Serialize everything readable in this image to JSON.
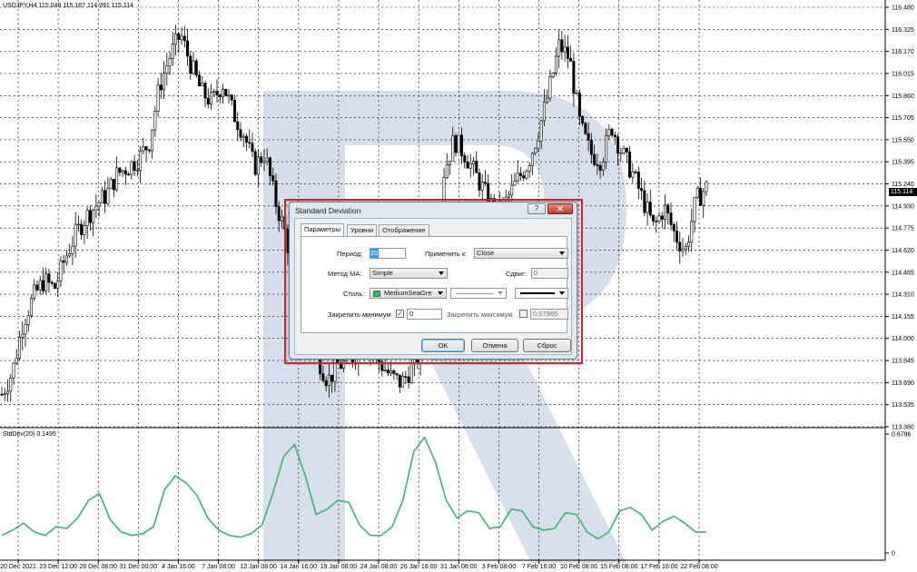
{
  "chart": {
    "symbol_caption": "USDJPY,H4  115.049 115.167 114.991 115.114",
    "current_price": "115.114",
    "indicator_caption": "StdDev(20) 0.1495",
    "price_ticks": [
      "116.480",
      "116.325",
      "116.170",
      "116.015",
      "115.860",
      "115.705",
      "115.550",
      "115.395",
      "115.240",
      "114.930",
      "114.775",
      "114.620",
      "114.465",
      "114.310",
      "114.155",
      "114.000",
      "113.845",
      "113.690",
      "113.535",
      "113.380"
    ],
    "indicator_ticks": [
      "0.6796",
      "0"
    ],
    "time_ticks": [
      "20 Dec 2021",
      "23 Dec 12:00",
      "28 Dec 08:00",
      "31 Dec 00:00",
      "4 Jan 16:00",
      "7 Jan 08:00",
      "12 Jan 08:00",
      "14 Jan 16:00",
      "19 Jan 08:00",
      "24 Jan 08:00",
      "26 Jan 16:00",
      "31 Jan 08:00",
      "3 Feb 08:00",
      "7 Feb 16:00",
      "10 Feb 08:00",
      "15 Feb 08:00",
      "17 Feb 16:00",
      "22 Feb 08:00"
    ],
    "colors": {
      "up_candle": "#000000",
      "indicator_line": "#3cb371",
      "grid": "#000000",
      "watermark": "#c9d3e6",
      "highlight_frame": "#e21d24"
    }
  },
  "chart_data": {
    "type": "line",
    "title": "USDJPY,H4",
    "series": [
      {
        "name": "USDJPY close",
        "values": [
          113.62,
          113.78,
          114.15,
          114.34,
          114.46,
          114.4,
          114.62,
          114.8,
          114.93,
          115.02,
          115.1,
          115.25,
          115.3,
          115.36,
          115.48,
          115.9,
          116.12,
          116.28,
          116.05,
          115.85,
          115.78,
          115.92,
          115.7,
          115.55,
          115.3,
          115.4,
          115.05,
          114.8,
          114.4,
          114.1,
          113.9,
          113.72,
          113.84,
          113.85,
          113.96,
          113.98,
          113.85,
          113.75,
          113.7,
          113.82,
          113.95,
          114.4,
          115.25,
          115.5,
          115.4,
          115.25,
          115.1,
          114.95,
          115.05,
          115.2,
          115.32,
          115.55,
          115.85,
          116.2,
          116.1,
          115.6,
          115.4,
          115.35,
          115.6,
          115.4,
          115.25,
          115.05,
          114.85,
          115.0,
          114.8,
          114.68,
          115.05,
          115.15
        ]
      },
      {
        "name": "StdDev(20)",
        "values": [
          0.1,
          0.13,
          0.17,
          0.12,
          0.1,
          0.15,
          0.14,
          0.2,
          0.3,
          0.34,
          0.19,
          0.12,
          0.1,
          0.11,
          0.15,
          0.36,
          0.44,
          0.4,
          0.33,
          0.2,
          0.13,
          0.1,
          0.09,
          0.11,
          0.16,
          0.34,
          0.55,
          0.62,
          0.44,
          0.22,
          0.25,
          0.3,
          0.29,
          0.16,
          0.1,
          0.1,
          0.15,
          0.3,
          0.58,
          0.66,
          0.52,
          0.3,
          0.2,
          0.24,
          0.23,
          0.14,
          0.15,
          0.25,
          0.24,
          0.15,
          0.13,
          0.14,
          0.23,
          0.22,
          0.12,
          0.08,
          0.12,
          0.24,
          0.26,
          0.22,
          0.13,
          0.18,
          0.21,
          0.17,
          0.12,
          0.12
        ]
      }
    ],
    "price_range": [
      113.38,
      116.48
    ],
    "indicator_range": [
      0,
      0.6796
    ],
    "grid": true
  },
  "dialog": {
    "title": "Standard Deviation",
    "help": "?",
    "close": "✕",
    "tabs": [
      "Параметры",
      "Уровни",
      "Отображение"
    ],
    "period_label": "Период:",
    "period_value": "20",
    "apply_label": "Применить к:",
    "apply_value": "Close",
    "ma_method_label": "Метод МА:",
    "ma_method_value": "Simple",
    "shift_label": "Сдвиг:",
    "shift_value": "0",
    "style_label": "Стиль:",
    "color_value": "MediumSeaGre",
    "fix_min_label": "Закрепить минимум",
    "fix_min_value": "0",
    "fix_min_checked": "✓",
    "fix_max_label": "Закрепить максимум",
    "fix_max_value": "0.67965",
    "ok": "OK",
    "cancel": "Отмена",
    "reset": "Сброс"
  }
}
